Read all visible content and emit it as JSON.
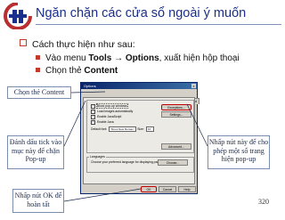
{
  "slide": {
    "title": "Ngăn chặn các cửa sổ ngoài ý muốn",
    "bullet_main": "Cách thực hiện như sau:",
    "sub_bullets": [
      {
        "prefix": "Vào menu ",
        "bold": "Tools → Options",
        "suffix": ", xuất hiện hộp thoại"
      },
      {
        "prefix": "Chọn thẻ ",
        "bold": "Content",
        "suffix": ""
      }
    ],
    "page_number": "320"
  },
  "callouts": {
    "content_tab": "Chọn thẻ Content",
    "block_popup": "Đánh dấu tick vào mục này để chặn Pop-up",
    "exceptions": "Nhấp nút này để cho phép một số trang hiện pop-up",
    "ok": "Nhấp nút OK để hoàn tất"
  },
  "dialog": {
    "title": "Options",
    "close": "x",
    "tabs": [
      "Main",
      "Tabs",
      "Content",
      "Applications",
      "Privacy",
      "Security",
      "Advanced"
    ],
    "active_tab": "Content",
    "options": [
      {
        "label": "Block pop-up windows",
        "checked": true
      },
      {
        "label": "Load images automatically",
        "checked": true
      },
      {
        "label": "Enable JavaScript",
        "checked": true
      },
      {
        "label": "Enable Java",
        "checked": true
      }
    ],
    "exceptions_button": "Exceptions...",
    "settings_button": "Settings...",
    "default_font_label": "Default font:",
    "default_font_value": "Times New Roman",
    "size_label": "Size:",
    "size_value": "16",
    "advanced_button": "Advanced...",
    "languages_label": "Languages",
    "languages_text": "Choose your preferred language for displaying pages",
    "choose_button": "Choose...",
    "ok_button": "OK",
    "cancel_button": "Cancel",
    "help_button": "Help"
  },
  "colors": {
    "title": "#1a2f8c",
    "accent": "#c23a2a",
    "callout_border": "#7a8fb0"
  }
}
